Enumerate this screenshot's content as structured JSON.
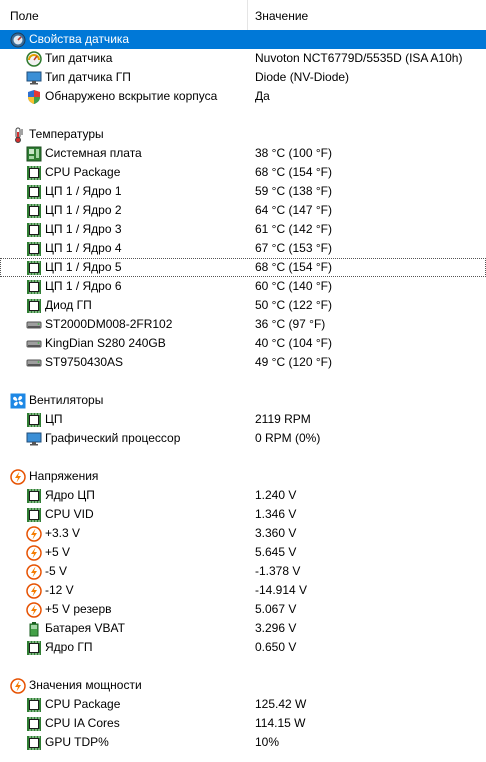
{
  "header": {
    "field": "Поле",
    "value": "Значение"
  },
  "rows": [
    {
      "kind": "group",
      "icon": "sensor-gauge-icon",
      "name": "Свойства датчика",
      "value": "",
      "selected": true
    },
    {
      "kind": "item",
      "icon": "gauge-icon",
      "name": "Тип датчика",
      "value": "Nuvoton NCT6779D/5535D  (ISA A10h)"
    },
    {
      "kind": "item",
      "icon": "monitor-icon",
      "name": "Тип датчика ГП",
      "value": "Diode  (NV-Diode)"
    },
    {
      "kind": "item",
      "icon": "shield-icon",
      "name": "Обнаружено вскрытие корпуса",
      "value": "Да"
    },
    {
      "kind": "blank"
    },
    {
      "kind": "group",
      "icon": "thermometer-icon",
      "name": "Температуры",
      "value": ""
    },
    {
      "kind": "item",
      "icon": "motherboard-icon",
      "name": "Системная плата",
      "value": "38 °C  (100 °F)"
    },
    {
      "kind": "item",
      "icon": "chip-icon",
      "name": "CPU Package",
      "value": "68 °C  (154 °F)"
    },
    {
      "kind": "item",
      "icon": "chip-icon",
      "name": "ЦП 1 / Ядро 1",
      "value": "59 °C  (138 °F)"
    },
    {
      "kind": "item",
      "icon": "chip-icon",
      "name": "ЦП 1 / Ядро 2",
      "value": "64 °C  (147 °F)"
    },
    {
      "kind": "item",
      "icon": "chip-icon",
      "name": "ЦП 1 / Ядро 3",
      "value": "61 °C  (142 °F)"
    },
    {
      "kind": "item",
      "icon": "chip-icon",
      "name": "ЦП 1 / Ядро 4",
      "value": "67 °C  (153 °F)"
    },
    {
      "kind": "item",
      "icon": "chip-icon",
      "name": "ЦП 1 / Ядро 5",
      "value": "68 °C  (154 °F)",
      "focused": true
    },
    {
      "kind": "item",
      "icon": "chip-icon",
      "name": "ЦП 1 / Ядро 6",
      "value": "60 °C  (140 °F)"
    },
    {
      "kind": "item",
      "icon": "chip-icon",
      "name": "Диод ГП",
      "value": "50 °C  (122 °F)"
    },
    {
      "kind": "item",
      "icon": "hard-drive-icon",
      "name": "ST2000DM008-2FR102",
      "value": "36 °C  (97 °F)"
    },
    {
      "kind": "item",
      "icon": "hard-drive-icon",
      "name": "KingDian S280 240GB",
      "value": "40 °C  (104 °F)"
    },
    {
      "kind": "item",
      "icon": "hard-drive-icon",
      "name": "ST9750430AS",
      "value": "49 °C  (120 °F)"
    },
    {
      "kind": "blank"
    },
    {
      "kind": "group",
      "icon": "fan-icon",
      "name": "Вентиляторы",
      "value": ""
    },
    {
      "kind": "item",
      "icon": "chip-icon",
      "name": "ЦП",
      "value": "2119 RPM"
    },
    {
      "kind": "item",
      "icon": "monitor-icon",
      "name": "Графический процессор",
      "value": "0 RPM  (0%)"
    },
    {
      "kind": "blank"
    },
    {
      "kind": "group",
      "icon": "voltage-icon",
      "name": "Напряжения",
      "value": ""
    },
    {
      "kind": "item",
      "icon": "chip-icon",
      "name": "Ядро ЦП",
      "value": "1.240 V"
    },
    {
      "kind": "item",
      "icon": "chip-icon",
      "name": "CPU VID",
      "value": "1.346 V"
    },
    {
      "kind": "item",
      "icon": "voltage-icon",
      "name": "+3.3 V",
      "value": "3.360 V"
    },
    {
      "kind": "item",
      "icon": "voltage-icon",
      "name": "+5 V",
      "value": "5.645 V"
    },
    {
      "kind": "item",
      "icon": "voltage-icon",
      "name": "-5 V",
      "value": "-1.378 V"
    },
    {
      "kind": "item",
      "icon": "voltage-icon",
      "name": "-12 V",
      "value": "-14.914 V"
    },
    {
      "kind": "item",
      "icon": "voltage-icon",
      "name": "+5 V резерв",
      "value": "5.067 V"
    },
    {
      "kind": "item",
      "icon": "battery-icon",
      "name": "Батарея VBAT",
      "value": "3.296 V"
    },
    {
      "kind": "item",
      "icon": "chip-icon",
      "name": "Ядро ГП",
      "value": "0.650 V"
    },
    {
      "kind": "blank"
    },
    {
      "kind": "group",
      "icon": "voltage-icon",
      "name": "Значения мощности",
      "value": ""
    },
    {
      "kind": "item",
      "icon": "chip-icon",
      "name": "CPU Package",
      "value": "125.42 W"
    },
    {
      "kind": "item",
      "icon": "chip-icon",
      "name": "CPU IA Cores",
      "value": "114.15 W"
    },
    {
      "kind": "item",
      "icon": "chip-icon",
      "name": "GPU TDP%",
      "value": "10%"
    }
  ]
}
